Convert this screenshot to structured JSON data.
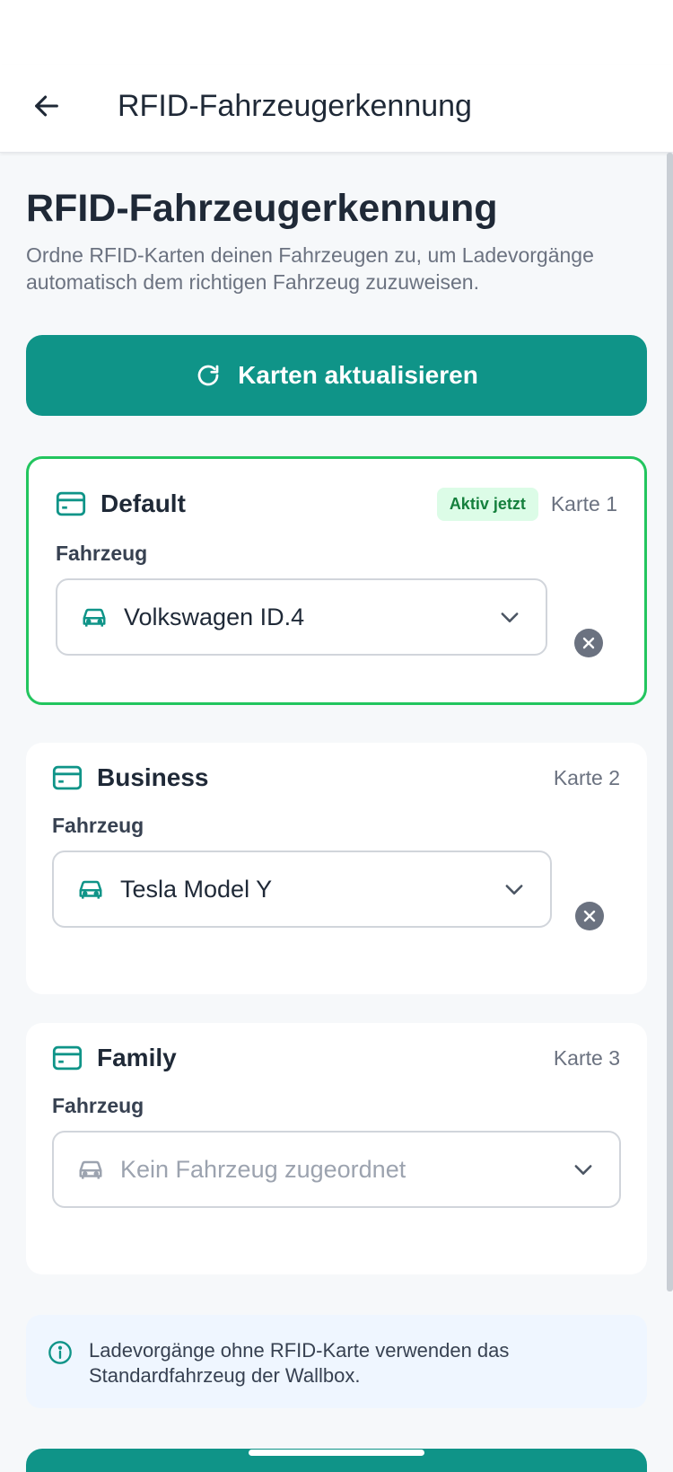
{
  "appbar": {
    "title": "RFID-Fahrzeugerkennung"
  },
  "page": {
    "title": "RFID-Fahrzeugerkennung",
    "description": "Ordne RFID-Karten deinen Fahrzeugen zu, um Ladevorgänge automatisch dem richtigen Fahrzeug zuzuweisen."
  },
  "refresh_button": {
    "label": "Karten aktualisieren"
  },
  "cards": [
    {
      "name": "Default",
      "badge": "Aktiv jetzt",
      "number": "Karte 1",
      "field_label": "Fahrzeug",
      "vehicle": "Volkswagen ID.4"
    },
    {
      "name": "Business",
      "number": "Karte 2",
      "field_label": "Fahrzeug",
      "vehicle": "Tesla Model Y"
    },
    {
      "name": "Family",
      "number": "Karte 3",
      "field_label": "Fahrzeug",
      "vehicle_placeholder": "Kein Fahrzeug zugeordnet"
    }
  ],
  "info": {
    "text": "Ladevorgänge ohne RFID-Karte verwenden das Standardfahrzeug der Wallbox."
  },
  "colors": {
    "accent": "#0f9488",
    "active_border": "#22c55e",
    "badge_bg": "#dcfce7",
    "badge_text": "#15803d"
  },
  "icons": {
    "back": "arrow-left-icon",
    "refresh": "refresh-icon",
    "card": "credit-card-icon",
    "car": "car-icon",
    "chevron": "chevron-down-icon",
    "clear": "close-circle-icon",
    "info": "info-icon"
  }
}
